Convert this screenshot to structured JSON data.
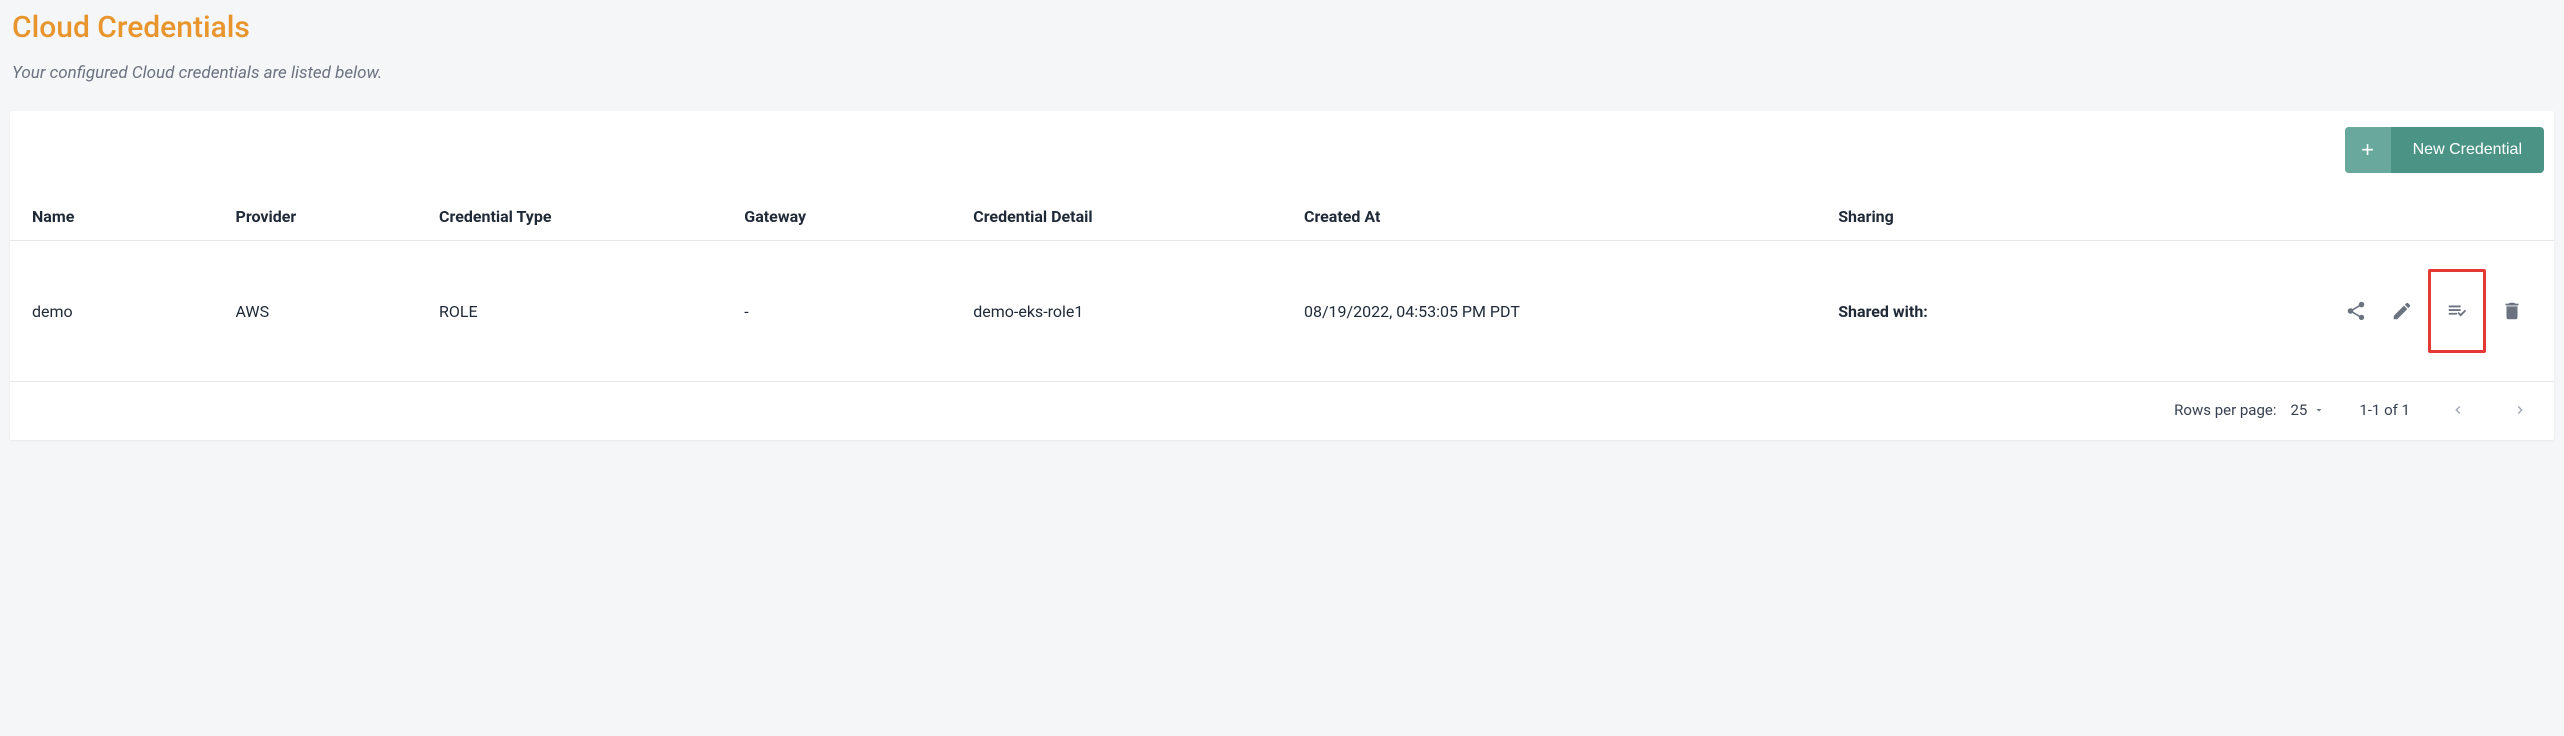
{
  "header": {
    "title": "Cloud Credentials",
    "subtitle": "Your configured Cloud credentials are listed below."
  },
  "toolbar": {
    "newCredentialLabel": "New Credential"
  },
  "table": {
    "headers": {
      "name": "Name",
      "provider": "Provider",
      "credentialType": "Credential Type",
      "gateway": "Gateway",
      "credentialDetail": "Credential Detail",
      "createdAt": "Created At",
      "sharing": "Sharing"
    },
    "rows": [
      {
        "name": "demo",
        "provider": "AWS",
        "credentialType": "ROLE",
        "gateway": "-",
        "credentialDetail": "demo-eks-role1",
        "createdAt": "08/19/2022, 04:53:05 PM PDT",
        "sharing": "Shared with:"
      }
    ]
  },
  "pagination": {
    "rowsPerPageLabel": "Rows per page:",
    "rowsPerPageValue": "25",
    "rangeLabel": "1-1 of 1"
  }
}
